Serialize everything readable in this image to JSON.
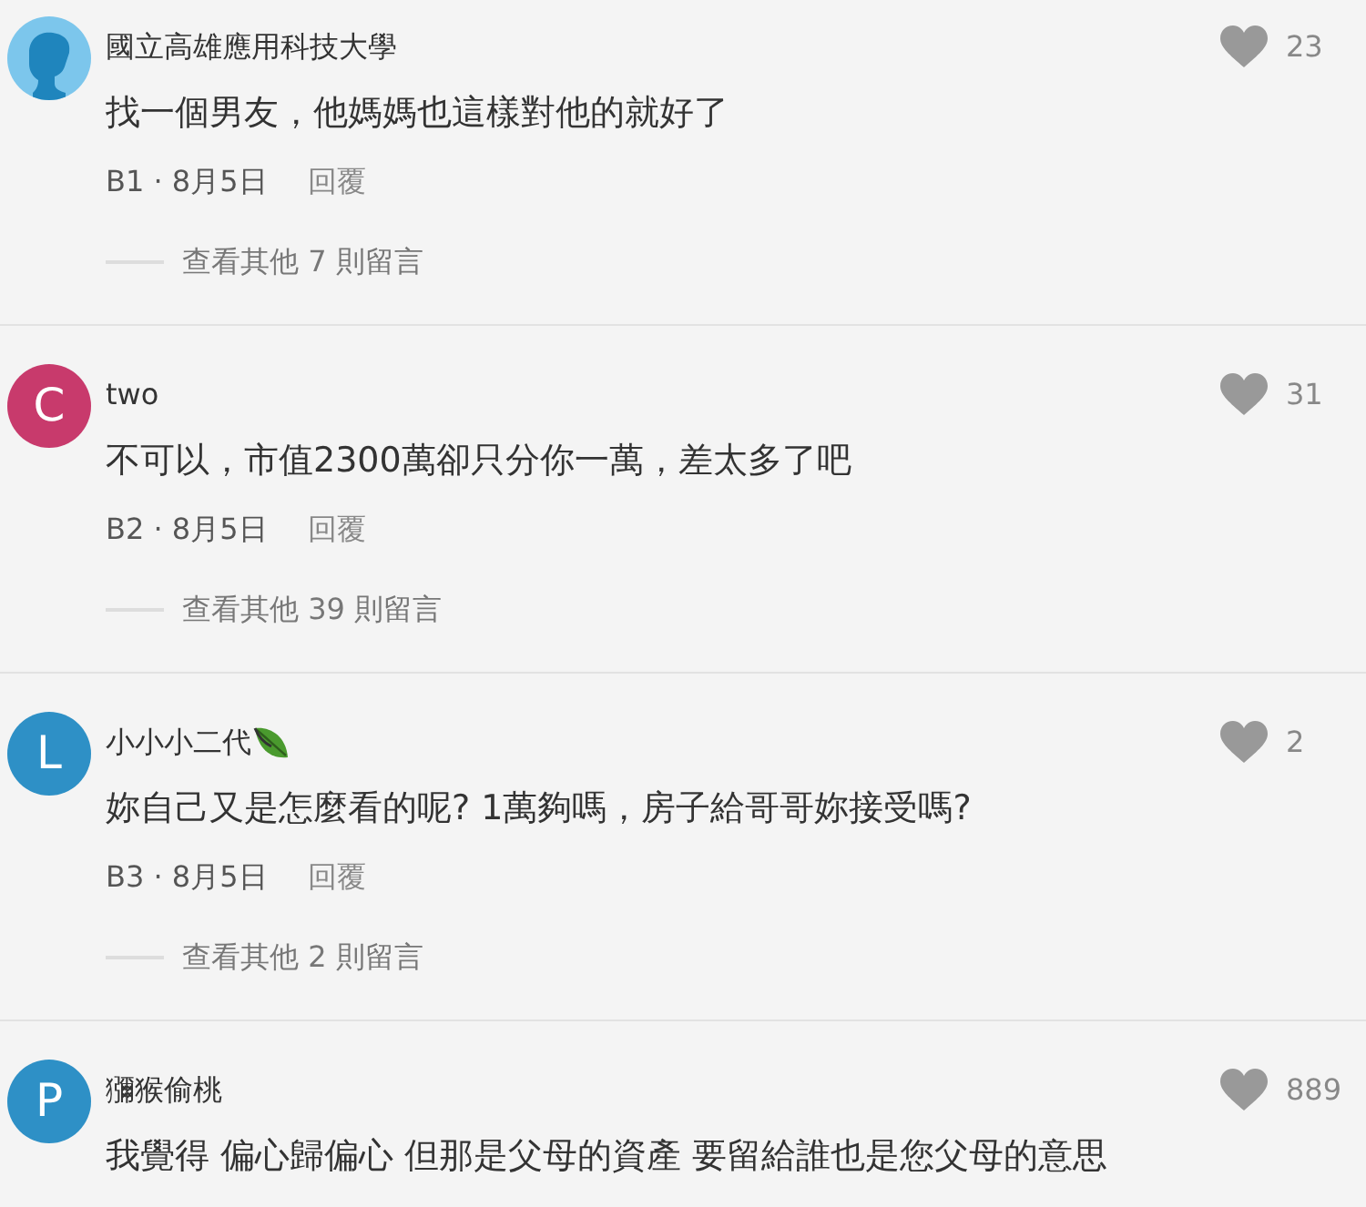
{
  "comments": [
    {
      "avatar": {
        "kind": "silhouette",
        "color": "#7cc6ec"
      },
      "author": "國立高雄應用科技大學",
      "badge": false,
      "likes": "23",
      "body": "找一個男友，他媽媽也這樣對他的就好了",
      "meta": "B1 · 8月5日",
      "reply": "回覆",
      "more_replies": "查看其他 7 則留言"
    },
    {
      "avatar": {
        "kind": "letter",
        "letter": "C",
        "color": "#c83a6c"
      },
      "author": "two",
      "badge": false,
      "likes": "31",
      "body": "不可以，市值2300萬卻只分你一萬，差太多了吧",
      "meta": "B2 · 8月5日",
      "reply": "回覆",
      "more_replies": "查看其他 39 則留言"
    },
    {
      "avatar": {
        "kind": "letter",
        "letter": "L",
        "color": "#2e90c6"
      },
      "author": "小小小二代",
      "badge": true,
      "likes": "2",
      "body": "妳自己又是怎麼看的呢? 1萬夠嗎，房子給哥哥妳接受嗎?",
      "meta": "B3 · 8月5日",
      "reply": "回覆",
      "more_replies": "查看其他 2 則留言"
    },
    {
      "avatar": {
        "kind": "letter",
        "letter": "P",
        "color": "#2e90c6"
      },
      "author": "獼猴偷桃",
      "badge": false,
      "likes": "889",
      "body": "我覺得 偏心歸偏心 但那是父母的資產 要留給誰也是您父母的意思"
    }
  ]
}
